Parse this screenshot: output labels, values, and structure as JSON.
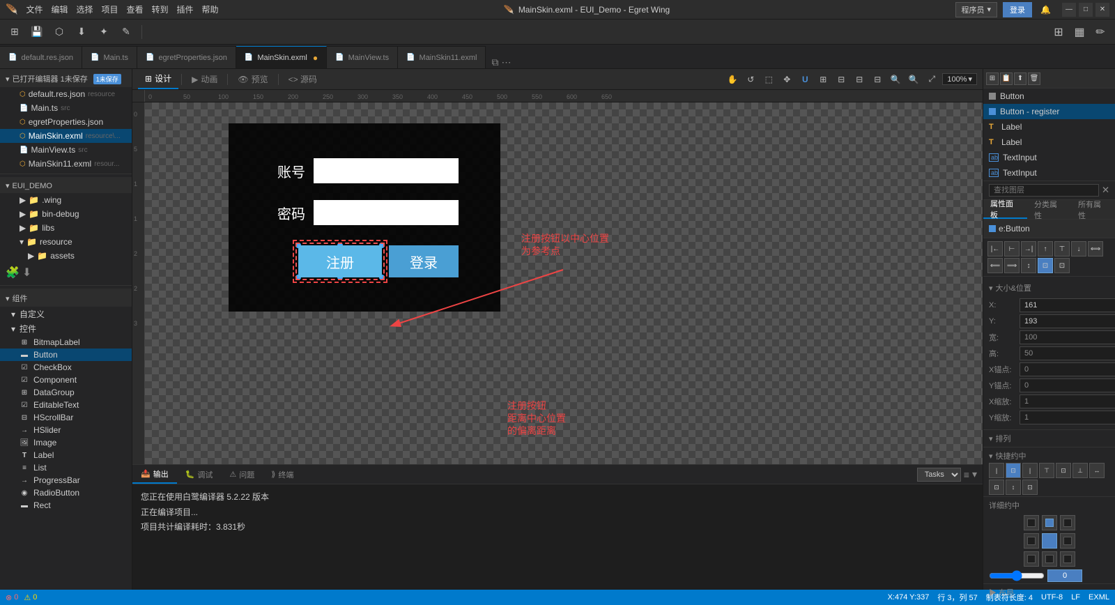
{
  "app": {
    "title": "MainSkin.exml - EUI_Demo - Egret Wing",
    "logo": "🪶"
  },
  "titlebar": {
    "menu_items": [
      "文件",
      "编辑",
      "选择",
      "项目",
      "查看",
      "转到",
      "插件",
      "帮助"
    ],
    "user_label": "程序员",
    "login_label": "登录",
    "win_minimize": "—",
    "win_maximize": "□",
    "win_close": "✕"
  },
  "toolbar": {
    "buttons": [
      "⊞",
      "💾",
      "⬡",
      "⬇",
      "✦",
      "✎"
    ]
  },
  "tabs": [
    {
      "id": "default",
      "label": "default.res.json",
      "icon": "📄",
      "dirty": false
    },
    {
      "id": "main",
      "label": "Main.ts",
      "icon": "📄",
      "dirty": false
    },
    {
      "id": "egret",
      "label": "egretProperties.json",
      "icon": "📄",
      "dirty": false
    },
    {
      "id": "mainskin",
      "label": "MainSkin.exml",
      "icon": "📄",
      "dirty": true,
      "active": true
    },
    {
      "id": "mainview",
      "label": "MainView.ts",
      "icon": "📄",
      "dirty": false
    },
    {
      "id": "mainskin11",
      "label": "MainSkin11.exml",
      "icon": "📄",
      "dirty": false
    }
  ],
  "design_tabs": [
    {
      "id": "design",
      "label": "设计",
      "active": true
    },
    {
      "id": "animation",
      "label": "动画"
    },
    {
      "id": "preview",
      "label": "预览"
    },
    {
      "id": "code",
      "label": "<> 源码"
    }
  ],
  "sidebar": {
    "file_section_title": "已打开编辑器 1未保存",
    "files": [
      {
        "name": "default.res.json",
        "type": "resource",
        "indent": 1
      },
      {
        "name": "Main.ts",
        "type": "src",
        "indent": 1
      },
      {
        "name": "egretProperties.json",
        "type": "",
        "indent": 1
      },
      {
        "name": "MainSkin.exml",
        "type": "resource\\...",
        "indent": 1
      },
      {
        "name": "MainView.ts",
        "type": "src",
        "indent": 1
      },
      {
        "name": "MainSkin11.exml",
        "type": "resour...",
        "indent": 1
      }
    ],
    "project_title": "EUI_DEMO",
    "project_items": [
      {
        "name": ".wing",
        "indent": 1,
        "expandable": true
      },
      {
        "name": "bin-debug",
        "indent": 1,
        "expandable": true
      },
      {
        "name": "libs",
        "indent": 1,
        "expandable": true
      },
      {
        "name": "resource",
        "indent": 1,
        "expandable": true
      },
      {
        "name": "assets",
        "indent": 2,
        "expandable": true
      }
    ],
    "components_title": "组件",
    "custom_title": "自定义",
    "controls_title": "控件",
    "controls": [
      {
        "name": "BitmapLabel",
        "icon": "⊞"
      },
      {
        "name": "Button",
        "icon": "▬"
      },
      {
        "name": "CheckBox",
        "icon": "☑"
      },
      {
        "name": "Component",
        "icon": "☑"
      },
      {
        "name": "DataGroup",
        "icon": "⊞"
      },
      {
        "name": "EditableText",
        "icon": "☑"
      },
      {
        "name": "HScrollBar",
        "icon": "⊟"
      },
      {
        "name": "HSlider",
        "icon": "→"
      },
      {
        "name": "Image",
        "icon": "🖼"
      },
      {
        "name": "Label",
        "icon": "T"
      },
      {
        "name": "List",
        "icon": "≡"
      },
      {
        "name": "ProgressBar",
        "icon": "→"
      },
      {
        "name": "RadioButton",
        "icon": "◉"
      },
      {
        "name": "Rect",
        "icon": "▬"
      }
    ]
  },
  "layers": {
    "items": [
      {
        "name": "Button",
        "type": "button",
        "selected": false
      },
      {
        "name": "Button - register",
        "type": "button",
        "selected": true
      },
      {
        "name": "Label",
        "type": "label",
        "selected": false
      },
      {
        "name": "Label",
        "type": "label",
        "selected": false
      },
      {
        "name": "TextInput",
        "type": "input",
        "selected": false
      },
      {
        "name": "TextInput",
        "type": "input",
        "selected": false
      }
    ],
    "search_placeholder": "查找图层"
  },
  "properties": {
    "tabs": [
      "属性面板",
      "分类属性",
      "所有属性"
    ],
    "component_name": "e:Button",
    "section_title": "大小&位置",
    "fields": {
      "x": {
        "label": "X:",
        "value": "161"
      },
      "y": {
        "label": "Y:",
        "value": "193"
      },
      "width": {
        "label": "宽:",
        "value": "100"
      },
      "height": {
        "label": "高:",
        "value": "50"
      },
      "anchorX": {
        "label": "X锚点:",
        "value": "0"
      },
      "anchorY": {
        "label": "Y锚点:",
        "value": "0"
      },
      "scaleX": {
        "label": "X缩放:",
        "value": "1"
      },
      "scaleY": {
        "label": "Y缩放:",
        "value": "1"
      }
    },
    "sort_label": "排列",
    "quick_align_label": "快捷约中",
    "detail_label": "详细约中",
    "detail_value": "0",
    "layout_label": "布局"
  },
  "canvas": {
    "form": {
      "account_label": "账号",
      "password_label": "密码",
      "register_btn": "注册",
      "login_btn": "登录"
    }
  },
  "annotations": {
    "text1": "注册按钮以中心位置\n为参考点",
    "text2": "注册按钮\n距离中心位置\n的偏离距离"
  },
  "bottom_panel": {
    "tabs": [
      "输出",
      "调试",
      "问题",
      "终端"
    ],
    "active_tab": "输出",
    "task_options": [
      "Tasks"
    ],
    "messages": [
      "您正在使用白鹭编译器 5.2.22 版本",
      "正在编译项目...",
      "项目共计编译耗时：3.831秒"
    ]
  },
  "statusbar": {
    "errors": "0",
    "warnings": "0",
    "position": "行 3，列 57",
    "table_length": "制表符长度: 4",
    "encoding": "UTF-8",
    "line_endings": "LF",
    "language": "EXML",
    "coordinates": "X:474 Y:337"
  },
  "zoom": {
    "value": "100%"
  }
}
